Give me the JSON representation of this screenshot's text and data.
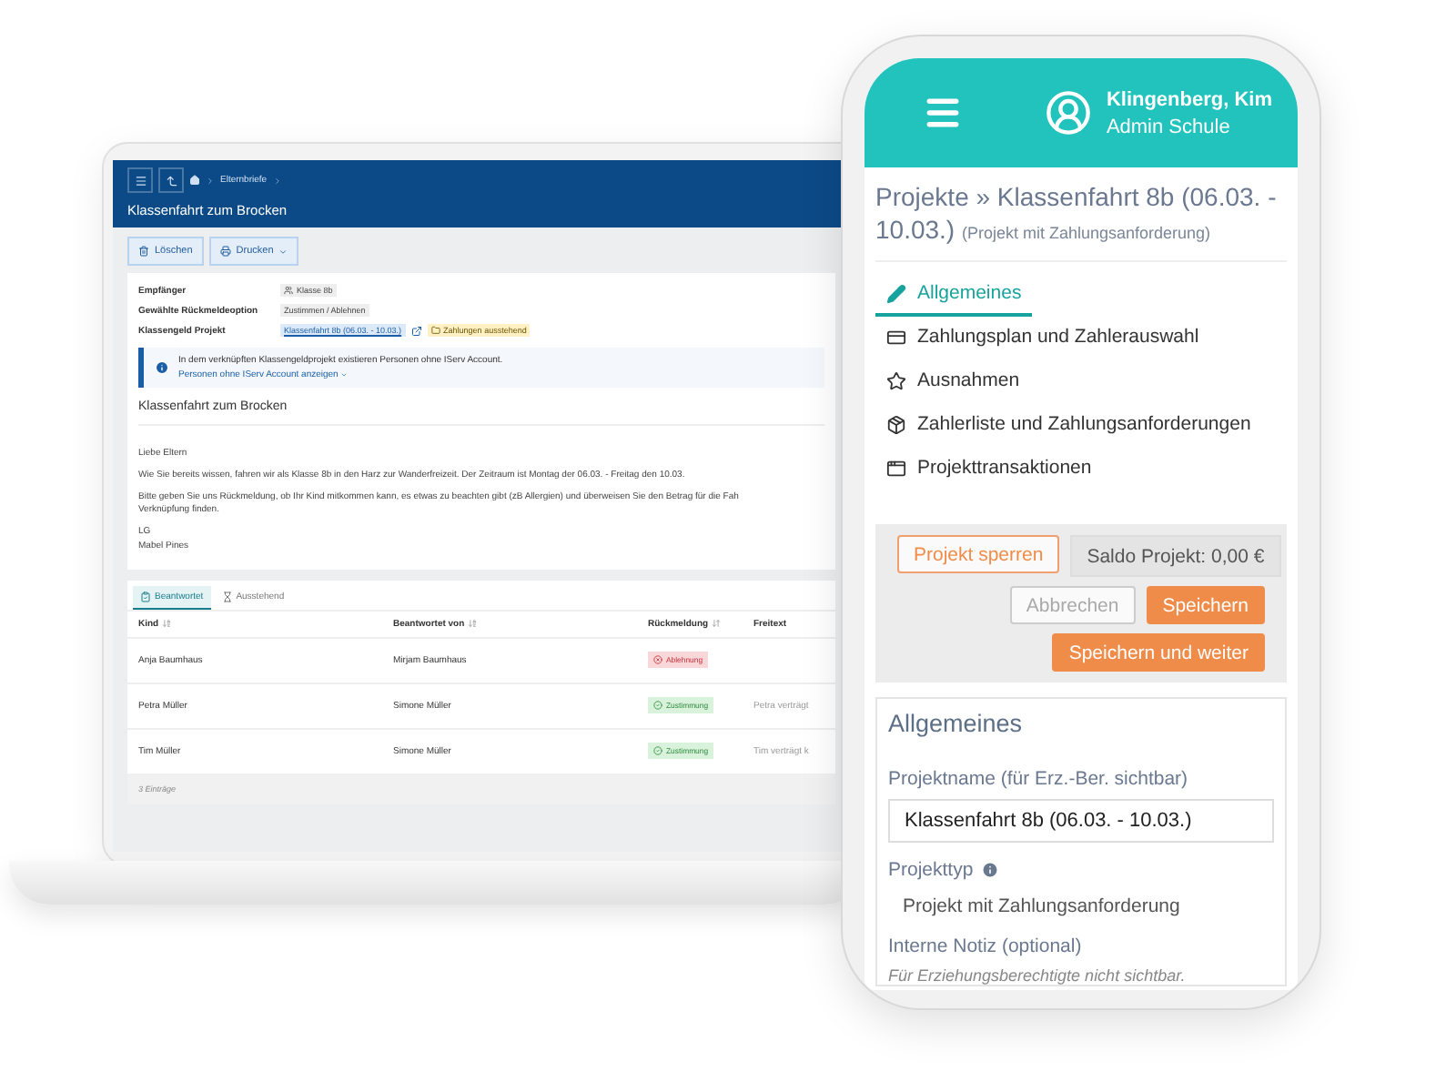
{
  "laptop": {
    "breadcrumb": "Elternbriefe",
    "page_title": "Klassenfahrt zum Brocken",
    "toolbar": [
      {
        "label": "Löschen",
        "kind": "delete",
        "menu": false
      },
      {
        "label": "Drucken",
        "kind": "print",
        "menu": true
      }
    ],
    "details": [
      {
        "label": "Empfänger",
        "kind": "group",
        "value": "Klasse 8b"
      },
      {
        "label": "Gewählte Rückmeldeoption",
        "kind": "tag",
        "value": "Zustimmen / Ablehnen"
      },
      {
        "label": "Klassengeld Projekt",
        "kind": "link",
        "value": "Klassenfahrt 8b (06.03. - 10.03.)",
        "status": "Zahlungen ausstehend"
      }
    ],
    "notice": {
      "text": "In dem verknüpften Klassengeldprojekt existieren Personen ohne IServ Account.",
      "link": "Personen ohne IServ Account anzeigen"
    },
    "letter": {
      "title": "Klassenfahrt zum Brocken",
      "paragraphs": [
        "Liebe Eltern",
        "Wie Sie bereits wissen, fahren wir als Klasse 8b in den Harz zur Wanderfreizeit. Der Zeitraum ist Montag der 06.03. - Freitag den 10.03.",
        "Bitte geben Sie uns Rückmeldung, ob Ihr Kind mitkommen kann, es etwas zu beachten gibt (zB Allergien) und überweisen Sie den Betrag für die Fah\nVerknüpfung finden.",
        "LG\nMabel Pines"
      ]
    },
    "tabs": [
      {
        "label": "Beantwortet",
        "kind": "answered",
        "selected": true
      },
      {
        "label": "Ausstehend",
        "kind": "pending",
        "selected": false
      }
    ],
    "table": {
      "columns": [
        "Kind",
        "Beantwortet von",
        "Rückmeldung",
        "Freitext"
      ],
      "rows": [
        {
          "child": "Anja Baumhaus",
          "answered_by": "Mirjam Baumhaus",
          "response": "Ablehnung",
          "kind": "declined",
          "note": ""
        },
        {
          "child": "Petra Müller",
          "answered_by": "Simone Müller",
          "response": "Zustimmung",
          "kind": "approved",
          "note": "Petra verträgt"
        },
        {
          "child": "Tim Müller",
          "answered_by": "Simone Müller",
          "response": "Zustimmung",
          "kind": "approved",
          "note": "Tim verträgt k"
        }
      ]
    },
    "footer": "3 Einträge"
  },
  "phone": {
    "user": {
      "name": "Klingenberg, Kim",
      "role": "Admin Schule"
    },
    "title": "Projekte » Klassenfahrt 8b (06.03. - 10.03.)",
    "subtitle": "(Projekt mit Zahlungsanforderung)",
    "nav": [
      {
        "label": "Allgemeines",
        "selected": true
      },
      {
        "label": "Zahlungsplan und Zahlerauswahl",
        "selected": false
      },
      {
        "label": "Ausnahmen",
        "selected": false
      },
      {
        "label": "Zahlerliste und Zahlungsanforderungen",
        "selected": false
      },
      {
        "label": "Projekttransaktionen",
        "selected": false
      }
    ],
    "actions": {
      "lock": "Projekt sperren",
      "balance": "Saldo Projekt: 0,00 €",
      "cancel": "Abbrechen",
      "save": "Speichern",
      "save_continue": "Speichern und weiter"
    },
    "section": {
      "title": "Allgemeines",
      "fields": [
        {
          "kind": "input",
          "label": "Projektname (für Erz.-Ber. sichtbar)",
          "value": "Klassenfahrt 8b (06.03. - 10.03.)",
          "info": false
        },
        {
          "kind": "static",
          "label": "Projekttyp",
          "value": "Projekt mit Zahlungsanforderung",
          "info": true
        },
        {
          "kind": "hint",
          "label": "Interne Notiz (optional)",
          "value": "Für Erziehungsberechtigte nicht sichtbar.",
          "info": false
        }
      ]
    }
  }
}
